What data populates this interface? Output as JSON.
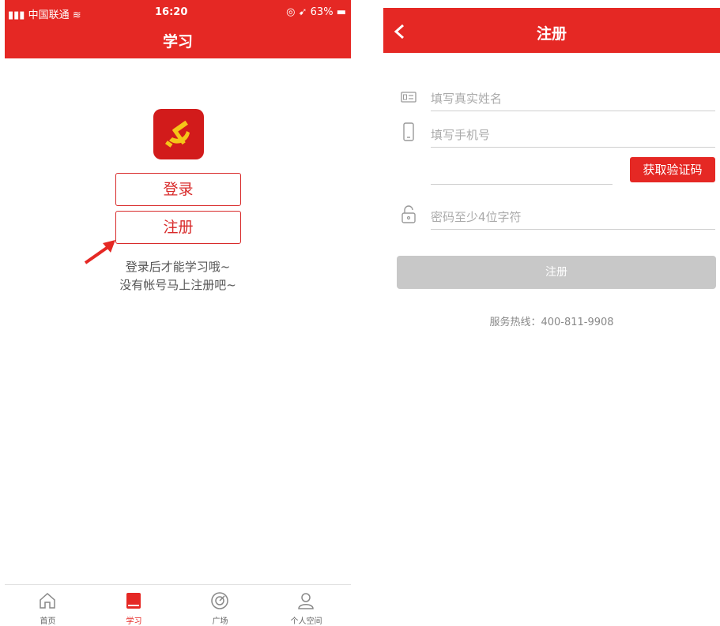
{
  "left_screen": {
    "status_bar": {
      "carrier": "中国联通",
      "time": "16:20",
      "battery": "63%"
    },
    "header_title": "学习",
    "login_button": "登录",
    "register_button": "注册",
    "hint_line1": "登录后才能学习哦~",
    "hint_line2": "没有帐号马上注册吧~",
    "tabs": [
      {
        "label": "首页",
        "icon": "home-icon"
      },
      {
        "label": "学习",
        "icon": "book-icon"
      },
      {
        "label": "广场",
        "icon": "target-icon"
      },
      {
        "label": "个人空间",
        "icon": "person-icon"
      }
    ],
    "active_tab": 1
  },
  "right_screen": {
    "header_title": "注册",
    "name_placeholder": "填写真实姓名",
    "phone_placeholder": "填写手机号",
    "code_button": "获取验证码",
    "password_placeholder": "密码至少4位字符",
    "submit_button": "注册",
    "hotline": "服务热线：400-811-9908"
  },
  "colors": {
    "brand_red": "#e52824",
    "logo_yellow": "#f5c518",
    "disabled_gray": "#c8c8c8"
  }
}
